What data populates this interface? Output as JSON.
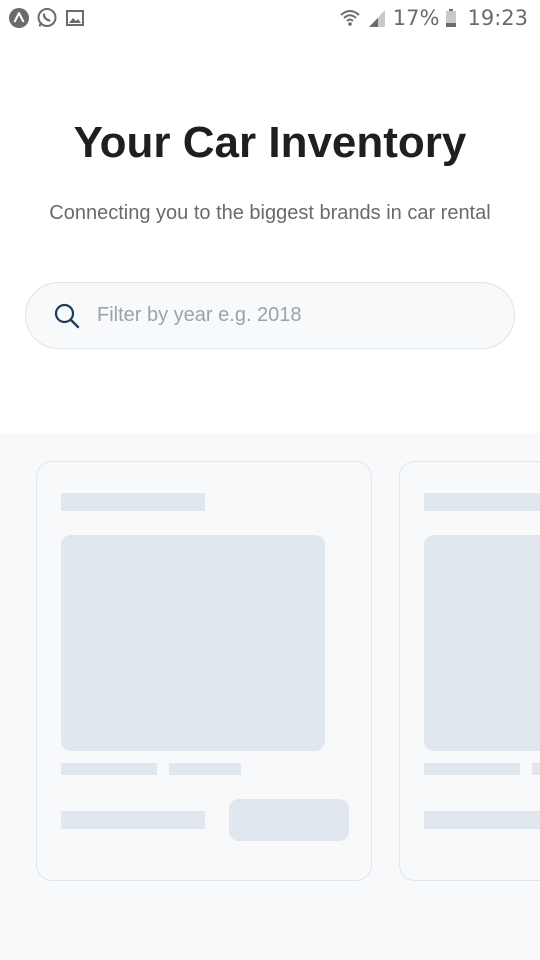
{
  "status_bar": {
    "battery_percent": "17%",
    "time": "19:23",
    "left_icons": [
      "app-a-icon",
      "whatsapp-icon",
      "gallery-icon"
    ],
    "right_icons": [
      "wifi-icon",
      "signal-icon",
      "battery-icon"
    ]
  },
  "header": {
    "title": "Your Car Inventory",
    "subtitle": "Connecting you to the biggest brands in car rental"
  },
  "search": {
    "placeholder": "Filter by year e.g. 2018",
    "value": "",
    "icon": "search-icon"
  },
  "cards": {
    "state": "loading-skeleton",
    "count_visible": 2
  },
  "colors": {
    "title": "#1f1f1f",
    "subtitle": "#6a6a6a",
    "search_icon": "#1f3b57",
    "skeleton": "#e1e7ef",
    "section_bg": "#f7f9fb"
  }
}
